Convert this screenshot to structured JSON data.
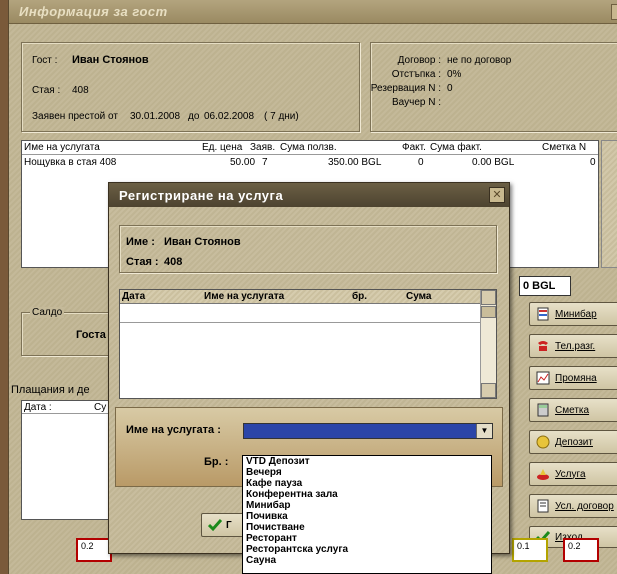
{
  "main_window": {
    "title": "Информация за гост",
    "guest_label": "Гост :",
    "guest_name": "Иван Стоянов",
    "room_label": "Стая :",
    "room_value": "408",
    "stay_label": "Заявен престой от",
    "stay_from": "30.01.2008",
    "stay_to_label": "до",
    "stay_to": "06.02.2008",
    "stay_days": "( 7 дни)",
    "contract_label": "Договор :",
    "contract_value": "не по договор",
    "discount_label": "Отстъпка :",
    "discount_value": "0%",
    "reservation_label": "Резервация N :",
    "reservation_value": "0",
    "voucher_label": "Ваучер N :",
    "voucher_value": ""
  },
  "services_grid": {
    "columns": [
      "Име на услугата",
      "Ед. цена",
      "Заяв.",
      "Сума ползв.",
      "Факт.",
      "Сума факт.",
      "Сметка N"
    ],
    "rows": [
      [
        "Нощувка в стая 408",
        "50.00",
        "7",
        "350.00 BGL",
        "0",
        "0.00 BGL",
        "0"
      ]
    ]
  },
  "total_amount": "0 BGL",
  "saldo": {
    "title": "Салдо",
    "guest_label": "Госта"
  },
  "payments": {
    "title": "Плащания и де",
    "col_date": "Дата :",
    "col_sum": "Су"
  },
  "side_buttons": [
    {
      "label": "Минибар",
      "icon": "minibar-icon"
    },
    {
      "label": "Тел.разг.",
      "icon": "phone-icon"
    },
    {
      "label": "Промяна",
      "icon": "chart-icon"
    },
    {
      "label": "Сметка",
      "icon": "calculator-icon"
    },
    {
      "label": "Депозит",
      "icon": "coin-icon"
    },
    {
      "label": "Услуга",
      "icon": "service-icon"
    },
    {
      "label": "Усл. договор",
      "icon": "contract-icon"
    },
    {
      "label": "Изход",
      "icon": "checkmark-icon"
    }
  ],
  "bottom_chips": [
    "0.2",
    "0.1",
    "0.2"
  ],
  "modal": {
    "title": "Регистриране на услуга",
    "name_label": "Име :",
    "name_value": "Иван Стоянов",
    "room_label": "Стая :",
    "room_value": "408",
    "grid_columns": [
      "Дата",
      "Име на услугата",
      "бр.",
      "Сума"
    ],
    "service_field_label": "Име на услугата :",
    "qty_label": "Бр. :",
    "ok_label": "Г",
    "dropdown_options": [
      "VTD Депозит",
      "Вечеря",
      "Кафе пауза",
      "Конферентна зала",
      "Минибар",
      "Почивка",
      "Почистване",
      "Ресторант",
      "Ресторантска услуга",
      "Сауна"
    ]
  },
  "colors": {
    "title_bar": "#4d4330",
    "selection": "#2b45a8",
    "panel": "#c4b999",
    "accent_red": "#b30000"
  }
}
